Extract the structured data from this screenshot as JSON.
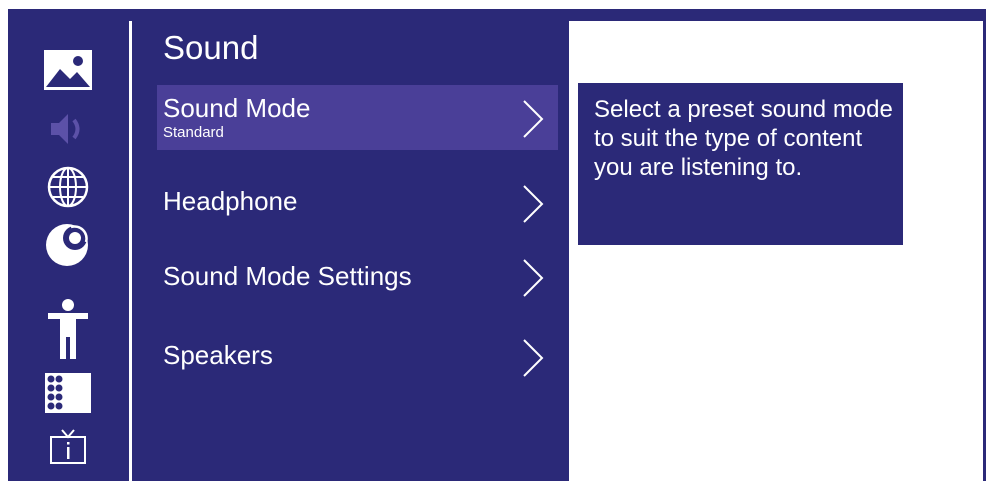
{
  "menu": {
    "title": "Sound",
    "items": [
      {
        "label": "Sound Mode",
        "value": "Standard"
      },
      {
        "label": "Headphone",
        "value": ""
      },
      {
        "label": "Sound Mode Settings",
        "value": ""
      },
      {
        "label": "Speakers",
        "value": ""
      }
    ]
  },
  "help": {
    "text": "Select a preset sound mode to suit the type of content you are listening to."
  },
  "sidebar": {
    "icons": [
      "picture-icon",
      "sound-icon",
      "network-icon",
      "channel-icon",
      "accessibility-icon",
      "apps-icon",
      "tv-info-icon"
    ]
  },
  "colors": {
    "panel": "#2b2978",
    "selected": "#4a3f98",
    "text": "#ffffff",
    "dimmed_icon": "#5c51a8"
  }
}
